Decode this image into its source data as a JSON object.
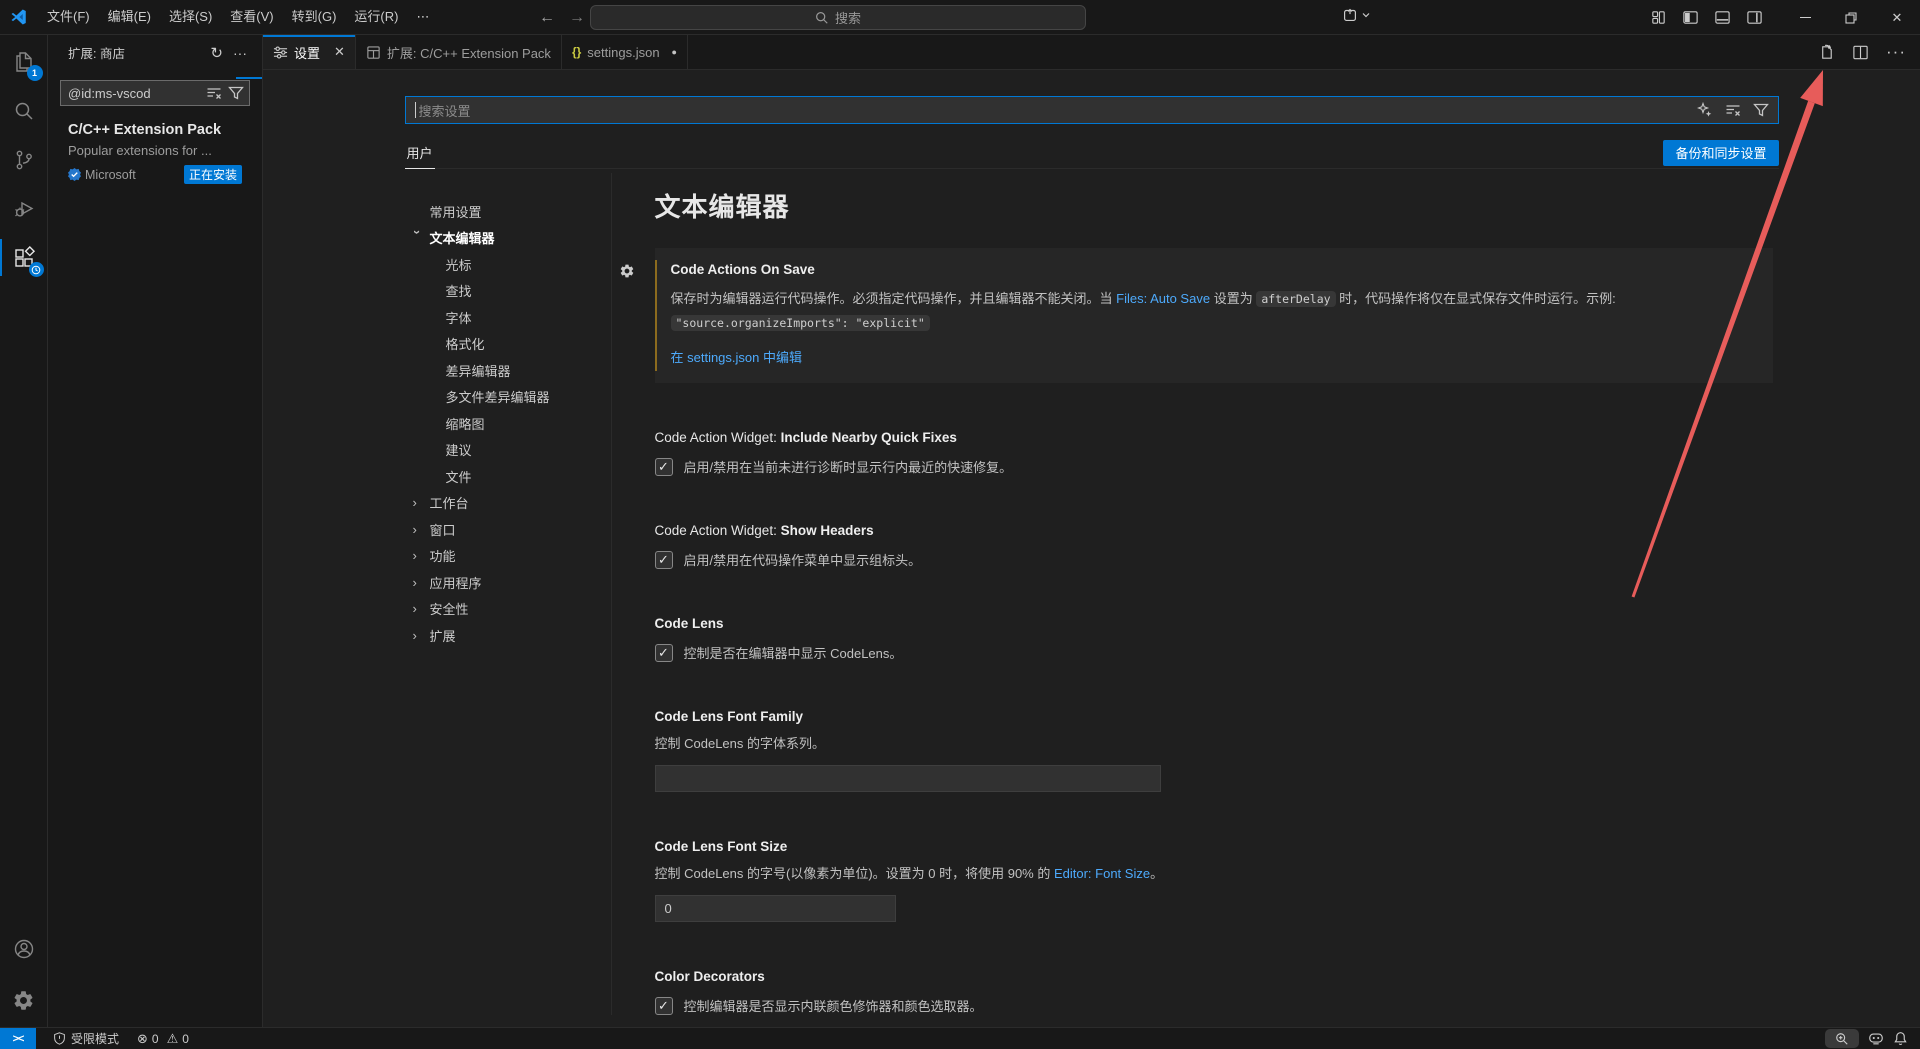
{
  "window": {
    "search_label": "搜索"
  },
  "menus": [
    "文件(F)",
    "编辑(E)",
    "选择(S)",
    "查看(V)",
    "转到(G)",
    "运行(R)",
    "⋯"
  ],
  "glyphs": {
    "back": "←",
    "forward": "→",
    "chevron": "›",
    "check": "✓",
    "close": "✕",
    "more_h": "···",
    "refresh": "↻",
    "dot": "●",
    "error": "⊗",
    "warning": "⚠"
  },
  "activity_bar": {
    "explorer_badge": "1"
  },
  "sidebar": {
    "title": "扩展: 商店",
    "search_value": "@id:ms-vscod",
    "extension": {
      "name": "C/C++ Extension Pack",
      "description": "Popular extensions for ...",
      "publisher": "Microsoft",
      "status_badge": "正在安装"
    }
  },
  "tabs": {
    "tab1": "设置",
    "tab2": "扩展: C/C++ Extension Pack",
    "tab3": "settings.json"
  },
  "settings": {
    "search_placeholder": "搜索设置",
    "scope_tab": "用户",
    "sync_button": "备份和同步设置",
    "heading": "文本编辑器",
    "toc": [
      {
        "label": "常用设置"
      },
      {
        "label": "文本编辑器"
      },
      {
        "label": "光标"
      },
      {
        "label": "查找"
      },
      {
        "label": "字体"
      },
      {
        "label": "格式化"
      },
      {
        "label": "差异编辑器"
      },
      {
        "label": "多文件差异编辑器"
      },
      {
        "label": "缩略图"
      },
      {
        "label": "建议"
      },
      {
        "label": "文件"
      },
      {
        "label": "工作台"
      },
      {
        "label": "窗口"
      },
      {
        "label": "功能"
      },
      {
        "label": "应用程序"
      },
      {
        "label": "安全性"
      },
      {
        "label": "扩展"
      }
    ],
    "code_actions_on_save": {
      "title": "Code Actions On Save",
      "desc_1": "保存时为编辑器运行代码操作。必须指定代码操作，并且编辑器不能关闭。当 ",
      "link_auto_save": "Files: Auto Save",
      "desc_2": " 设置为 ",
      "code_after_delay": "afterDelay",
      "desc_3": " 时，代码操作将仅在显式保存文件时运行。示例: ",
      "code_example": "\"source.organizeImports\": \"explicit\"",
      "edit_link": "在 settings.json 中编辑"
    },
    "rows": {
      "include_nearby": {
        "category": "Code Action Widget: ",
        "name": "Include Nearby Quick Fixes",
        "desc": "启用/禁用在当前未进行诊断时显示行内最近的快速修复。"
      },
      "show_headers": {
        "category": "Code Action Widget: ",
        "name": "Show Headers",
        "desc": "启用/禁用在代码操作菜单中显示组标头。"
      },
      "code_lens": {
        "category": "",
        "name": "Code Lens",
        "desc": "控制是否在编辑器中显示 CodeLens。"
      },
      "font_family": {
        "category": "",
        "name": "Code Lens Font Family",
        "desc": "控制 CodeLens 的字体系列。",
        "value": ""
      },
      "font_size": {
        "category": "",
        "name": "Code Lens Font Size",
        "desc_1": "控制 CodeLens 的字号(以像素为单位)。设置为 0 时，将使用 90% 的 ",
        "link": "Editor: Font Size",
        "desc_2": "。",
        "value": "0"
      },
      "color_decorators": {
        "category": "",
        "name": "Color Decorators",
        "desc": "控制编辑器是否显示内联颜色修饰器和颜色选取器。"
      }
    }
  },
  "status_bar": {
    "restricted_label": "受限模式",
    "remote_glyph": "><",
    "errors": "0",
    "warnings": "0"
  },
  "colors": {
    "accent": "#0078d4",
    "link": "#4daafc",
    "arrow": "#f2605e",
    "modified_indicator": "#8c6b1e"
  }
}
